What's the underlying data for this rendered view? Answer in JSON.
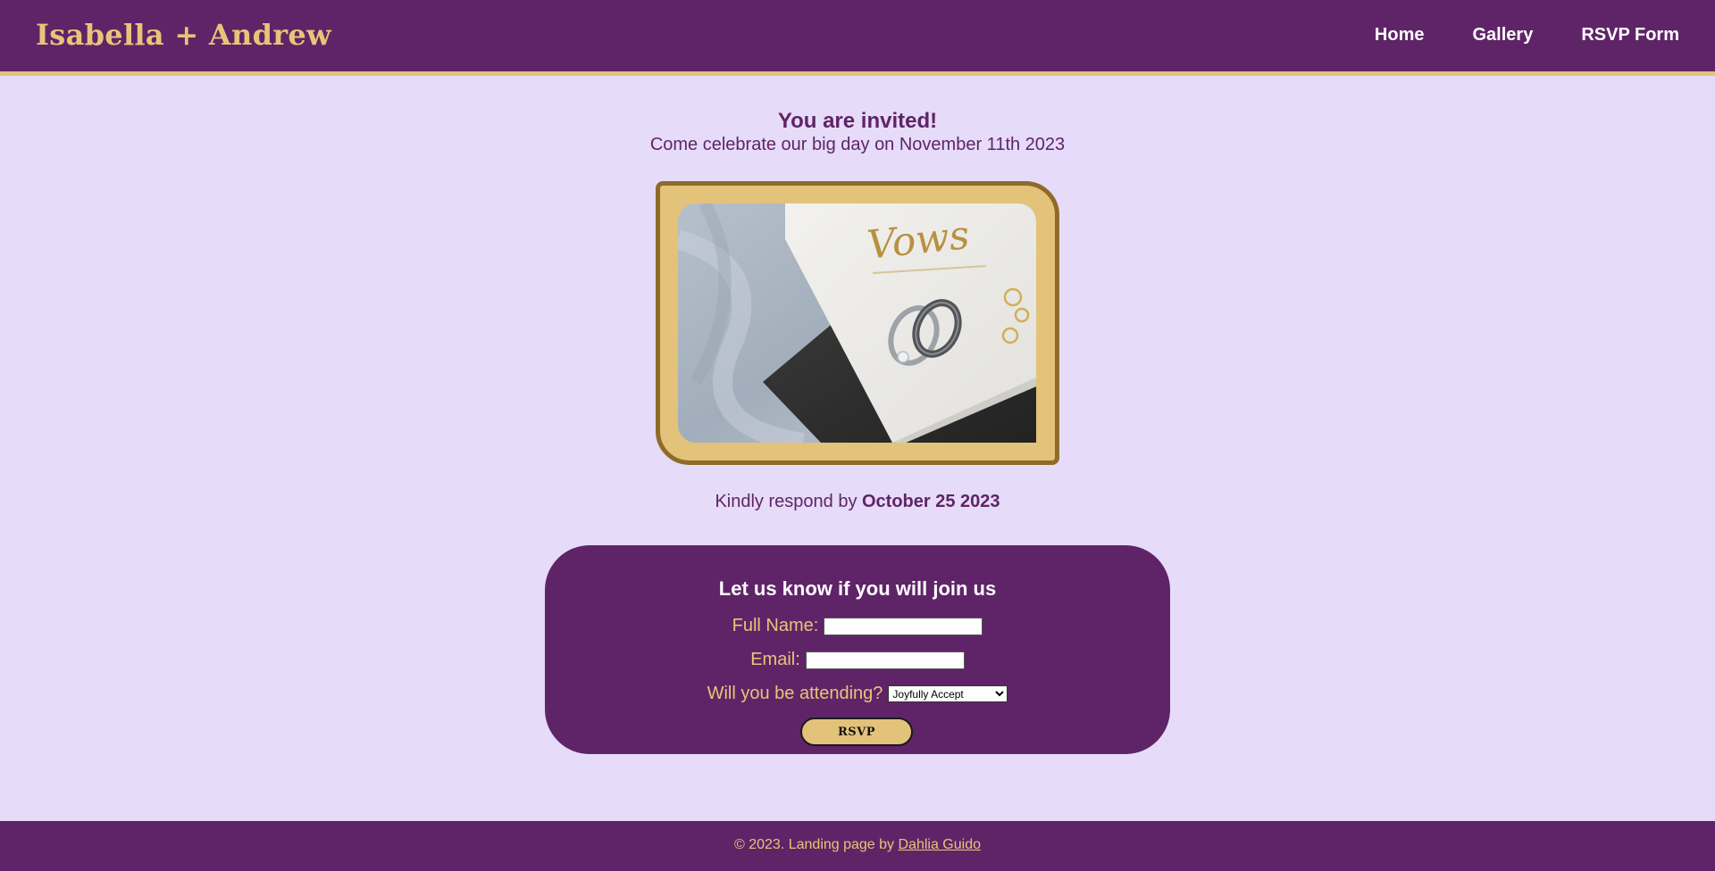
{
  "header": {
    "brand": "Isabella + Andrew",
    "nav": [
      {
        "label": "Home"
      },
      {
        "label": "Gallery"
      },
      {
        "label": "RSVP Form"
      }
    ]
  },
  "invite": {
    "title": "You are invited!",
    "subtitle": "Come celebrate our big day on November 11th 2023"
  },
  "photo": {
    "alt": "Vows booklet with wedding rings"
  },
  "respond": {
    "prefix": "Kindly respond by ",
    "date": "October 25 2023"
  },
  "rsvp": {
    "title": "Let us know if you will join us",
    "full_name_label": "Full Name:",
    "full_name_value": "",
    "email_label": "Email:",
    "email_value": "",
    "attending_label": "Will you be attending?",
    "attending_selected": "Joyfully Accept",
    "button_label": "RSVP"
  },
  "footer": {
    "prefix": "© 2023. Landing page by ",
    "author": "Dahlia Guido"
  },
  "colors": {
    "purple": "#5f2467",
    "gold": "#e3c27a",
    "lavender": "#e6dbf8",
    "frame_border": "#8f6b2a"
  }
}
